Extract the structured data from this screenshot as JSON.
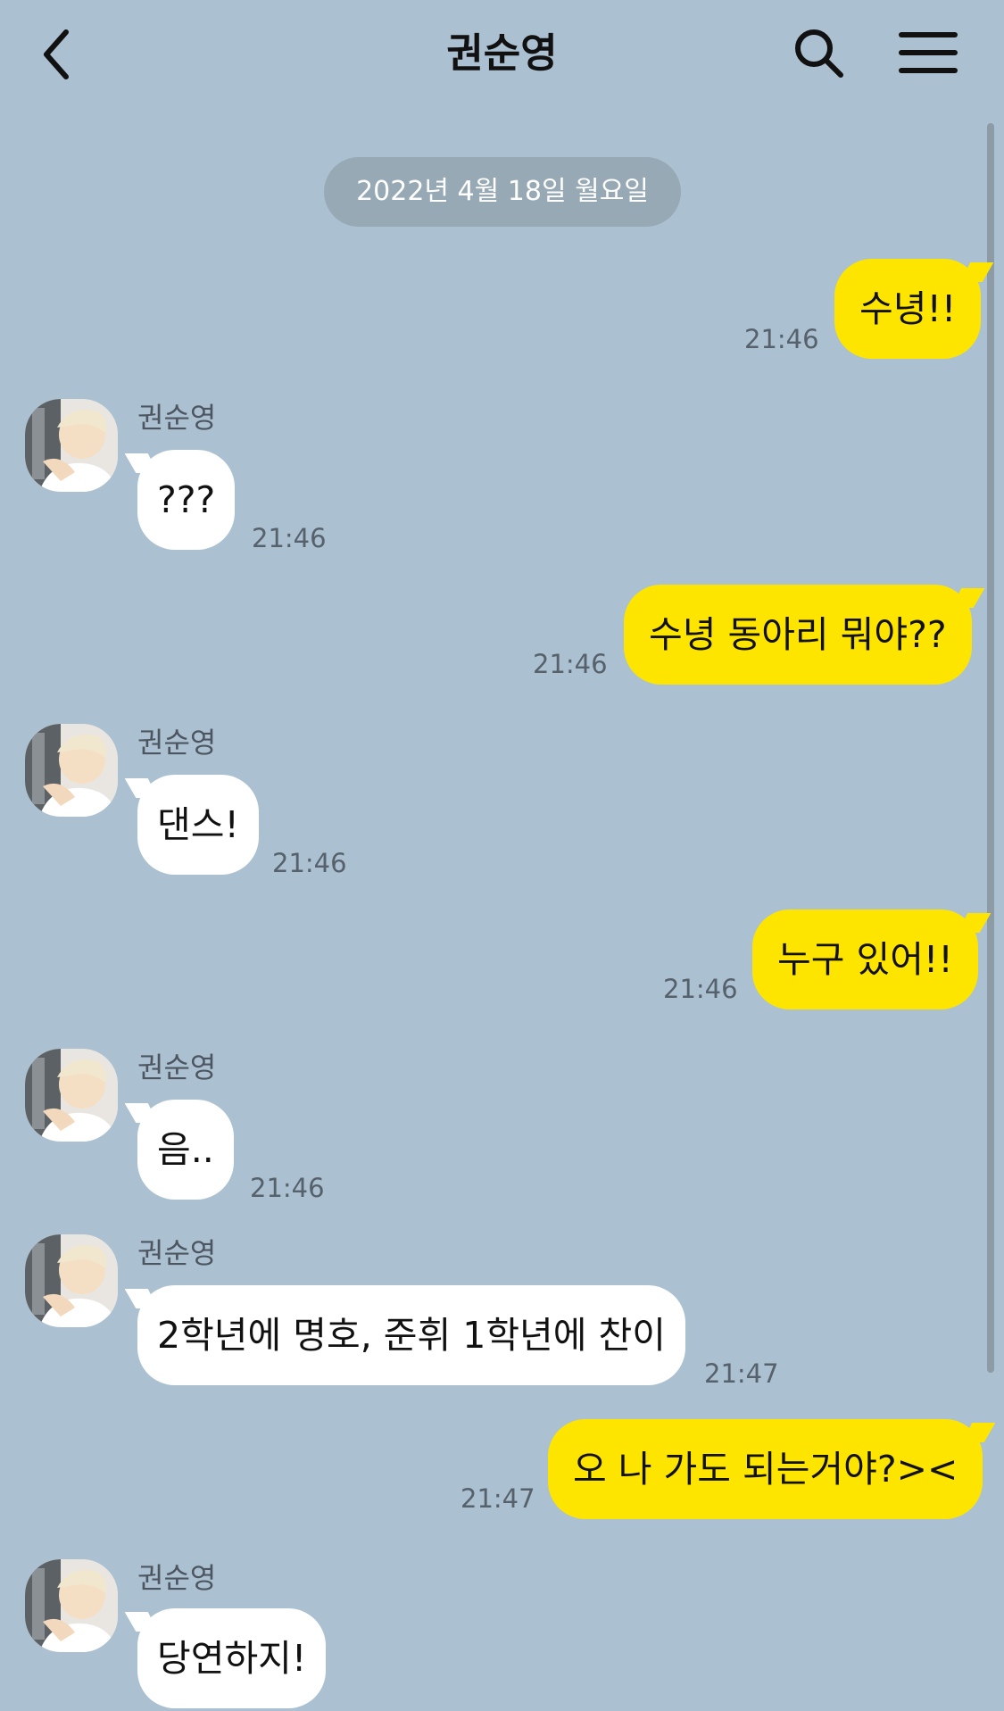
{
  "header": {
    "back_icon": "chevron-left-icon",
    "title": "권순영",
    "search_icon": "search-icon",
    "menu_icon": "hamburger-menu-icon"
  },
  "date_divider": "2022년 4월 18일 월요일",
  "messages": [
    {
      "direction": "out",
      "text": "수녕!!",
      "time": "21:46"
    },
    {
      "direction": "in",
      "sender": "권순영",
      "text": "???",
      "time": "21:46"
    },
    {
      "direction": "out",
      "text": "수녕 동아리 뭐야??",
      "time": "21:46"
    },
    {
      "direction": "in",
      "sender": "권순영",
      "text": "댄스!",
      "time": "21:46"
    },
    {
      "direction": "out",
      "text": "누구 있어!!",
      "time": "21:46"
    },
    {
      "direction": "in",
      "sender": "권순영",
      "text": "음..",
      "time": "21:46"
    },
    {
      "direction": "in",
      "sender": "권순영",
      "text": "2학년에 명호, 준휘 1학년에 찬이",
      "time": "21:47"
    },
    {
      "direction": "out",
      "text": "오 나 가도 되는거야?><",
      "time": "21:47"
    },
    {
      "direction": "in",
      "sender": "권순영",
      "text": "당연하지!",
      "time": ""
    }
  ],
  "colors": {
    "background": "#abc1d1",
    "outgoing_bubble": "#fee500",
    "incoming_bubble": "#ffffff",
    "date_pill": "#97a9b5"
  }
}
